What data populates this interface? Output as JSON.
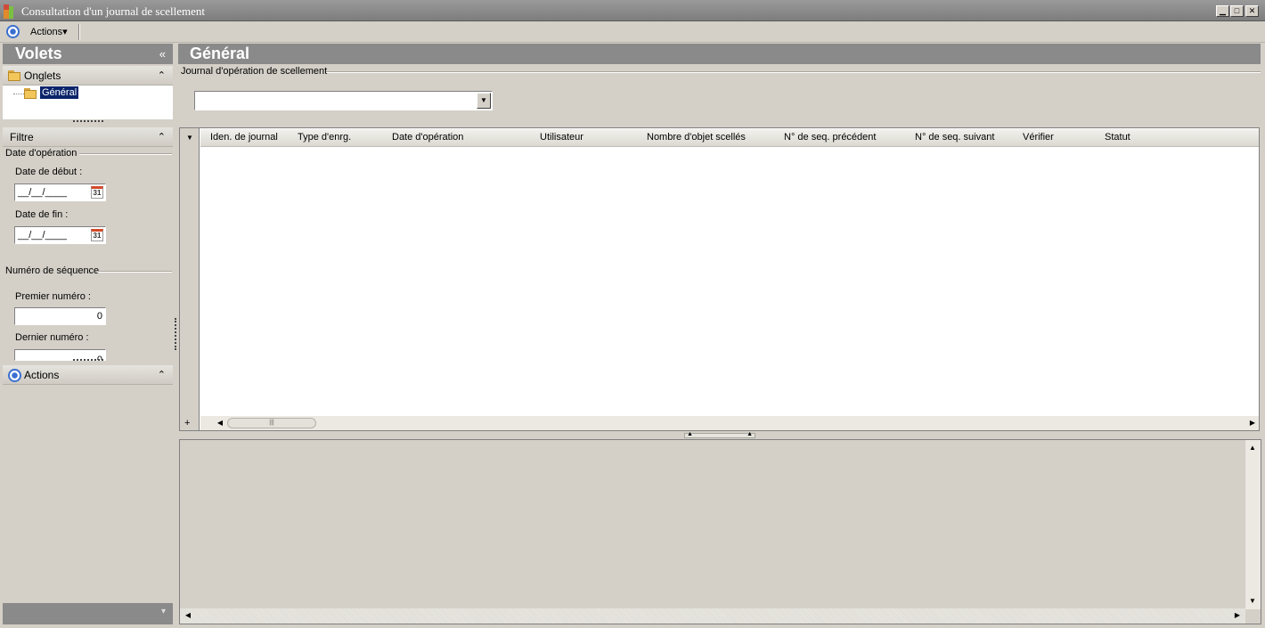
{
  "window": {
    "title": "Consultation d'un journal de scellement",
    "controls": {
      "minimize": "▁",
      "maximize": "□",
      "close": "✕"
    }
  },
  "toolbar": {
    "actions_label": "Actions",
    "dropdown_glyph": "▾"
  },
  "left_panel": {
    "header": "Volets",
    "collapse_glyph": "«",
    "onglets": {
      "title": "Onglets",
      "chevron": "⌃",
      "tree_item": "Général"
    },
    "filtre": {
      "title": "Filtre",
      "chevron": "⌃",
      "date_group": {
        "label": "Date d'opération",
        "start_label": "Date de début :",
        "start_value": "__/__/____",
        "end_label": "Date de fin :",
        "end_value": "__/__/____",
        "calendar_text": "31"
      },
      "sequence_group": {
        "label": "Numéro de séquence",
        "first_label": "Premier numéro :",
        "first_value": "0",
        "last_label": "Dernier numéro :",
        "last_value": "0"
      }
    },
    "actions": {
      "title": "Actions",
      "chevron": "⌃"
    },
    "footer_chevron": "▾"
  },
  "main": {
    "header": "Général",
    "journal_label": "Journal d'opération de scellement",
    "journal_value": "",
    "combo_arrow": "▼",
    "grid": {
      "menu_glyph": "▼",
      "add_glyph": "+",
      "columns": [
        "Iden. de journal",
        "Type d'enrg.",
        "Date d'opération",
        "Utilisateur",
        "Nombre d'objet scellés",
        "N° de seq. précédent",
        "N° de seq. suivant",
        "Vérifier",
        "Statut"
      ],
      "rows": [],
      "scroll_left": "◀",
      "scroll_right": "▶",
      "thumb_grip": "|||"
    },
    "splitter": {
      "up_glyph": "▲"
    },
    "detail": {
      "scroll_up": "▲",
      "scroll_down": "▼",
      "scroll_left": "◀",
      "scroll_right": "▶"
    }
  },
  "colors": {
    "header_bg": "#8a8a8a",
    "selection": "#0a246a",
    "accent_blue": "#3a6fd0",
    "panel_bg": "#d4d0c8"
  }
}
